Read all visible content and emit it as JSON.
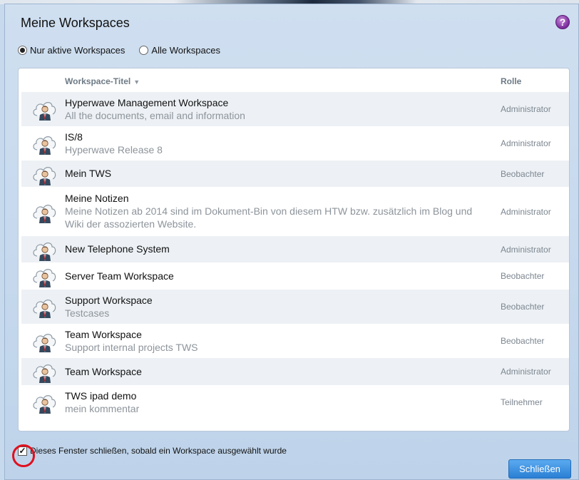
{
  "dialog": {
    "title": "Meine Workspaces",
    "help_icon": "help-icon"
  },
  "filters": {
    "options": [
      {
        "label": "Nur aktive Workspaces",
        "selected": true
      },
      {
        "label": "Alle Workspaces",
        "selected": false
      }
    ]
  },
  "table": {
    "columns": {
      "title": "Workspace-Titel",
      "role": "Rolle"
    },
    "sort_icon": "sort-descending-icon",
    "rows": [
      {
        "name": "Hyperwave Management Workspace",
        "desc": "All the documents, email and information",
        "role": "Administrator"
      },
      {
        "name": "IS/8",
        "desc": "Hyperwave Release 8",
        "role": "Administrator"
      },
      {
        "name": "Mein TWS",
        "desc": "",
        "role": "Beobachter"
      },
      {
        "name": "Meine Notizen",
        "desc": "Meine Notizen ab 2014 sind im Dokument-Bin von diesem HTW bzw. zusätzlich im Blog und Wiki der assozierten Website.",
        "role": "Administrator"
      },
      {
        "name": "New Telephone System",
        "desc": "",
        "role": "Administrator"
      },
      {
        "name": "Server Team Workspace",
        "desc": "",
        "role": "Beobachter"
      },
      {
        "name": "Support Workspace",
        "desc": "Testcases",
        "role": "Beobachter"
      },
      {
        "name": "Team Workspace",
        "desc": "Support internal projects TWS",
        "role": "Beobachter"
      },
      {
        "name": "Team Workspace",
        "desc": "",
        "role": "Administrator"
      },
      {
        "name": "TWS ipad demo",
        "desc": "mein kommentar",
        "role": "Teilnehmer"
      }
    ]
  },
  "footer": {
    "close_option": {
      "label": "Dieses Fenster schließen, sobald ein Workspace ausgewählt wurde",
      "checked": true
    },
    "close_button": "Schließen"
  },
  "colors": {
    "accent_button": "#2a7fd4",
    "highlight_ring": "#e0101e",
    "dialog_background": "#c7d9ec"
  }
}
